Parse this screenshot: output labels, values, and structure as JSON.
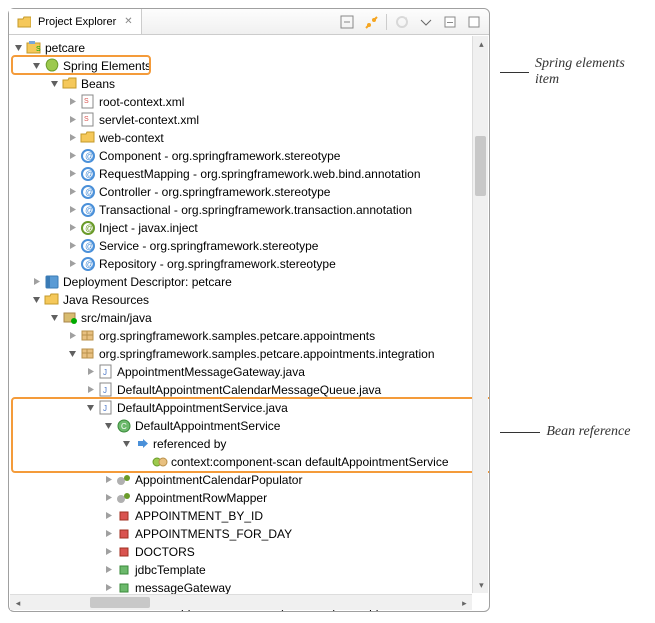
{
  "tab": {
    "title": "Project Explorer"
  },
  "annotations": {
    "spring_elements": "Spring elements item",
    "bean_reference": "Bean reference"
  },
  "tree": {
    "root": "petcare",
    "spring_elements": "Spring Elements",
    "beans": "Beans",
    "bean_items": [
      "root-context.xml",
      "servlet-context.xml",
      "web-context",
      "Component - org.springframework.stereotype",
      "RequestMapping - org.springframework.web.bind.annotation",
      "Controller - org.springframework.stereotype",
      "Transactional - org.springframework.transaction.annotation",
      "Inject - javax.inject",
      "Service - org.springframework.stereotype",
      "Repository - org.springframework.stereotype"
    ],
    "deployment_descriptor": "Deployment Descriptor: petcare",
    "java_resources": "Java Resources",
    "src_main_java": "src/main/java",
    "pkg1": "org.springframework.samples.petcare.appointments",
    "pkg2": "org.springframework.samples.petcare.appointments.integration",
    "file1": "AppointmentMessageGateway.java",
    "file2": "DefaultAppointmentCalendarMessageQueue.java",
    "file3": "DefaultAppointmentService.java",
    "class1": "DefaultAppointmentService",
    "ref": "referenced by",
    "scan": "context:component-scan defaultAppointmentService",
    "rest": [
      "AppointmentCalendarPopulator",
      "AppointmentRowMapper",
      "APPOINTMENT_BY_ID",
      "APPOINTMENTS_FOR_DAY",
      "DOCTORS",
      "jdbcTemplate",
      "messageGateway"
    ],
    "clipped": "DefaultAppointmentService(JdbcTemplate  AppointmentM"
  }
}
